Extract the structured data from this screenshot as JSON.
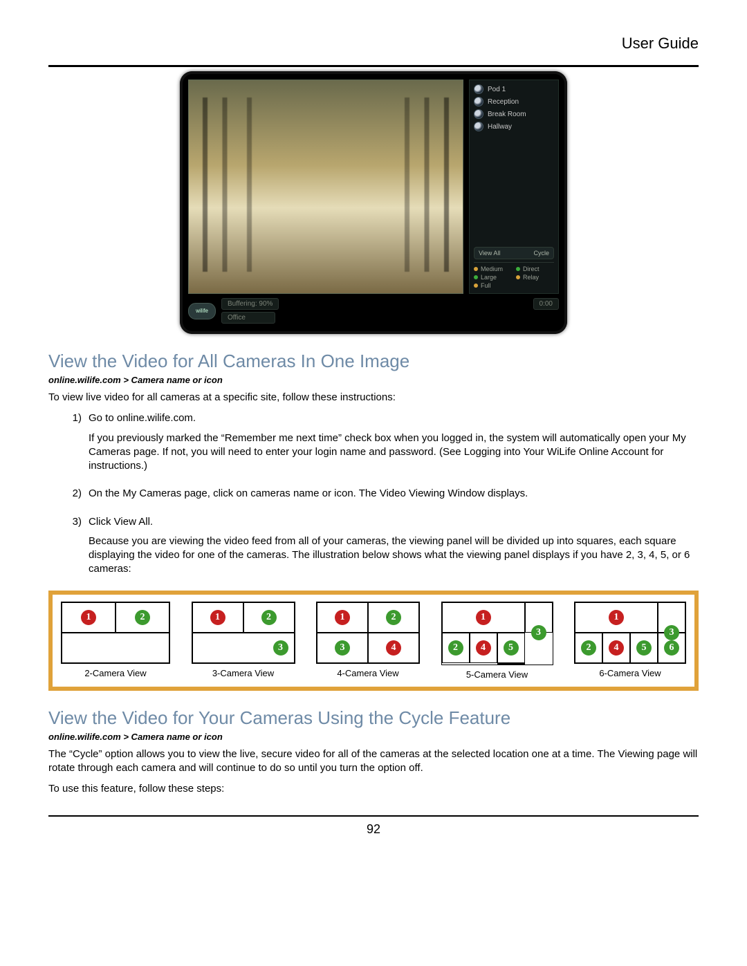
{
  "header": {
    "title": "User Guide"
  },
  "monitor": {
    "cameras": [
      "Pod 1",
      "Reception",
      "Break Room",
      "Hallway"
    ],
    "viewall": "View All",
    "cycle": "Cycle",
    "options_left": [
      "Medium",
      "Large",
      "Full"
    ],
    "options_right": [
      "Direct",
      "Relay"
    ],
    "logo": "wilife",
    "buffering": "Buffering: 90%",
    "time": "0:00",
    "location": "Office"
  },
  "section1": {
    "title": "View the Video for All Cameras In One Image",
    "breadcrumb": "online.wilife.com > Camera name or icon",
    "intro": "To view live video for all cameras at a specific site, follow these instructions:",
    "steps": [
      {
        "num": "1)",
        "lead": "Go to online.wilife.com.",
        "text": "If you previously marked the “Remember me next time” check box when you logged in, the system will automatically open your My Cameras page.  If not, you will need to enter your login name and password.  (See Logging into Your WiLife Online Account for instructions.)"
      },
      {
        "num": "2)",
        "lead": "On the My Cameras page, click on cameras name or icon. The Video Viewing Window displays.",
        "text": ""
      },
      {
        "num": "3)",
        "lead": "Click View All.",
        "text": "Because you are viewing the video feed from all of your cameras, the viewing panel will be divided up into squares, each square displaying the video for one of the cameras.  The illustration below shows what the viewing panel displays if you have 2, 3, 4, 5, or 6 cameras:"
      }
    ]
  },
  "camera_views": {
    "labels": [
      "2-Camera View",
      "3-Camera View",
      "4-Camera View",
      "5-Camera View",
      "6-Camera View"
    ]
  },
  "section2": {
    "title": "View the Video for Your Cameras Using the Cycle Feature",
    "breadcrumb": "online.wilife.com > Camera name or icon",
    "p1": "The “Cycle” option allows you to view the live, secure video for all of the cameras at the selected location one at a time.  The Viewing page will rotate through each camera and will continue to do so until you turn the option off.",
    "p2": "To use this feature, follow these steps:"
  },
  "page_number": "92"
}
